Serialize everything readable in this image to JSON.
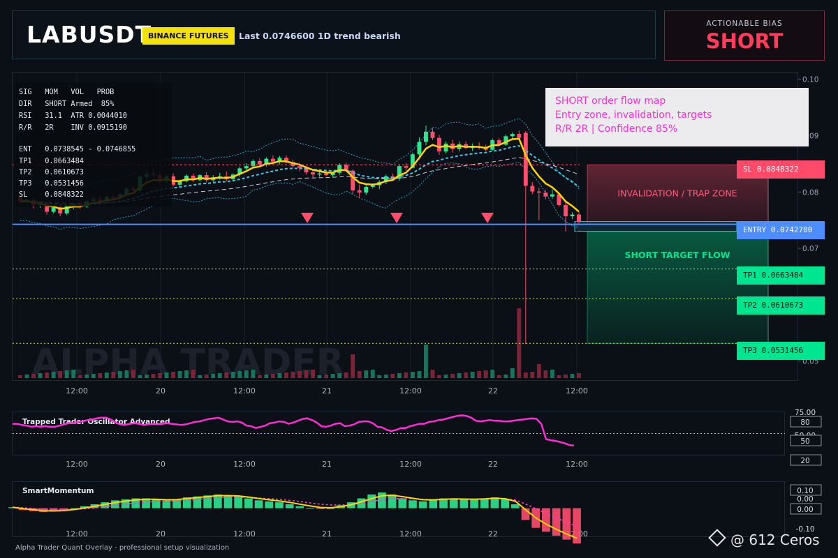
{
  "header": {
    "symbol": "LABUSDT",
    "exchange_badge": "BINANCE FUTURES",
    "status_line": "Last 0.0746600   1D trend bearish"
  },
  "bias": {
    "label": "ACTIONABLE BIAS",
    "value": "SHORT"
  },
  "colors": {
    "bull": "#2ee58f",
    "bear": "#ff4d6d",
    "ema": "#ffd400",
    "stop": "#ff5c7a",
    "entry": "#4d8dff",
    "target": "#00e58f",
    "accent_magenta": "#ff2bd6",
    "banner_yellow": "#f5e10a"
  },
  "stats_panel": {
    "rows": [
      "SIG   MOM   VOL   PROB",
      "DIR   SHORT Armed  85%",
      "RSI   31.1  ATR 0.0044010",
      "R/R   2R    INV 0.0915190",
      "",
      "ENT   0.0738545 - 0.0746855",
      "TP1   0.0663484",
      "TP2   0.0610673",
      "TP3   0.0531456",
      "SL    0.0848322"
    ]
  },
  "annotation_box": {
    "lines": [
      "SHORT order flow map",
      "Entry zone, invalidation, targets",
      "R/R 2R | Confidence 85%"
    ]
  },
  "watermark": "ALPHA TRADER",
  "zones": {
    "invalidation_label": "INVALIDATION / TRAP ZONE",
    "target_label": "SHORT TARGET FLOW"
  },
  "levels": [
    {
      "key": "sl",
      "label": "SL 0.0848322",
      "price": 0.0848322
    },
    {
      "key": "entry",
      "label": "ENTRY 0.0742700",
      "price": 0.07427
    },
    {
      "key": "tp1",
      "label": "TP1 0.0663484",
      "price": 0.0663484
    },
    {
      "key": "tp2",
      "label": "TP2 0.0610673",
      "price": 0.0610673
    },
    {
      "key": "tp3",
      "label": "TP3 0.0531456",
      "price": 0.0531456
    }
  ],
  "chart_data": {
    "type": "candlestick",
    "price_axis": {
      "ticks": [
        "0.10",
        "0.09",
        "0.08",
        "0.07",
        "0.06",
        "0.05"
      ],
      "tick_values": [
        0.1,
        0.09,
        0.08,
        0.07,
        0.06,
        0.05
      ],
      "ylim": [
        0.0465,
        0.1012
      ]
    },
    "time_axis": {
      "labels": [
        "12:00",
        "20",
        "12:00",
        "21",
        "12:00",
        "22",
        "12:00"
      ]
    },
    "candles": [
      [
        0.0791,
        0.0795,
        0.0777,
        0.0783
      ],
      [
        0.0783,
        0.0788,
        0.0778,
        0.0786
      ],
      [
        0.0786,
        0.079,
        0.0771,
        0.0776
      ],
      [
        0.0776,
        0.0786,
        0.0772,
        0.078
      ],
      [
        0.078,
        0.0784,
        0.076,
        0.0765
      ],
      [
        0.0765,
        0.0778,
        0.0762,
        0.0773
      ],
      [
        0.0773,
        0.0776,
        0.0757,
        0.0762
      ],
      [
        0.0762,
        0.0778,
        0.0759,
        0.0775
      ],
      [
        0.0775,
        0.0782,
        0.0769,
        0.0779
      ],
      [
        0.0779,
        0.0784,
        0.077,
        0.0774
      ],
      [
        0.0774,
        0.0786,
        0.0772,
        0.0784
      ],
      [
        0.0784,
        0.0792,
        0.078,
        0.0787
      ],
      [
        0.0787,
        0.0793,
        0.0781,
        0.0783
      ],
      [
        0.0783,
        0.0794,
        0.0782,
        0.0792
      ],
      [
        0.0792,
        0.0797,
        0.0786,
        0.0789
      ],
      [
        0.0789,
        0.0798,
        0.0787,
        0.0796
      ],
      [
        0.0796,
        0.0809,
        0.0794,
        0.0806
      ],
      [
        0.0806,
        0.0812,
        0.08,
        0.0803
      ],
      [
        0.0803,
        0.083,
        0.0801,
        0.0827
      ],
      [
        0.0827,
        0.0838,
        0.082,
        0.0832
      ],
      [
        0.0832,
        0.0839,
        0.0826,
        0.083
      ],
      [
        0.083,
        0.0836,
        0.0815,
        0.0819
      ],
      [
        0.0819,
        0.0831,
        0.0816,
        0.0828
      ],
      [
        0.0828,
        0.0833,
        0.081,
        0.0813
      ],
      [
        0.0813,
        0.0822,
        0.0809,
        0.0819
      ],
      [
        0.0819,
        0.0831,
        0.0817,
        0.0829
      ],
      [
        0.0829,
        0.0833,
        0.0818,
        0.0821
      ],
      [
        0.0821,
        0.0832,
        0.0819,
        0.083
      ],
      [
        0.083,
        0.0835,
        0.0817,
        0.0821
      ],
      [
        0.0821,
        0.083,
        0.0818,
        0.0826
      ],
      [
        0.0826,
        0.0834,
        0.0822,
        0.0828
      ],
      [
        0.0828,
        0.0836,
        0.0819,
        0.0823
      ],
      [
        0.0823,
        0.0833,
        0.082,
        0.0831
      ],
      [
        0.0831,
        0.0845,
        0.0827,
        0.0842
      ],
      [
        0.0842,
        0.0851,
        0.0836,
        0.0846
      ],
      [
        0.0846,
        0.0858,
        0.0842,
        0.0855
      ],
      [
        0.0855,
        0.086,
        0.0846,
        0.0849
      ],
      [
        0.0849,
        0.0862,
        0.0845,
        0.0859
      ],
      [
        0.0859,
        0.0865,
        0.0852,
        0.0854
      ],
      [
        0.0854,
        0.0864,
        0.0849,
        0.0861
      ],
      [
        0.0861,
        0.0865,
        0.0851,
        0.0853
      ],
      [
        0.0853,
        0.0858,
        0.0843,
        0.0846
      ],
      [
        0.0846,
        0.0852,
        0.0837,
        0.0843
      ],
      [
        0.0843,
        0.0846,
        0.0831,
        0.0835
      ],
      [
        0.0835,
        0.0839,
        0.0826,
        0.0831
      ],
      [
        0.0831,
        0.0836,
        0.0827,
        0.0833
      ],
      [
        0.0833,
        0.0838,
        0.0828,
        0.083
      ],
      [
        0.083,
        0.0836,
        0.0826,
        0.0834
      ],
      [
        0.0834,
        0.0851,
        0.083,
        0.0848
      ],
      [
        0.0848,
        0.0852,
        0.0835,
        0.0838
      ],
      [
        0.0838,
        0.084,
        0.0797,
        0.0803
      ],
      [
        0.0803,
        0.0813,
        0.079,
        0.0799
      ],
      [
        0.0799,
        0.0812,
        0.0795,
        0.0809
      ],
      [
        0.0809,
        0.0815,
        0.0806,
        0.0812
      ],
      [
        0.0812,
        0.0821,
        0.0805,
        0.0818
      ],
      [
        0.0818,
        0.0831,
        0.0814,
        0.0828
      ],
      [
        0.0828,
        0.0833,
        0.0821,
        0.0824
      ],
      [
        0.0824,
        0.0849,
        0.082,
        0.0846
      ],
      [
        0.0846,
        0.0852,
        0.0838,
        0.0843
      ],
      [
        0.0843,
        0.087,
        0.0842,
        0.0867
      ],
      [
        0.0867,
        0.0897,
        0.0858,
        0.0889
      ],
      [
        0.0889,
        0.0918,
        0.0883,
        0.0907
      ],
      [
        0.0907,
        0.0913,
        0.0892,
        0.0896
      ],
      [
        0.0896,
        0.0901,
        0.0866,
        0.0872
      ],
      [
        0.0872,
        0.089,
        0.0868,
        0.0886
      ],
      [
        0.0886,
        0.0893,
        0.087,
        0.0876
      ],
      [
        0.0876,
        0.089,
        0.0872,
        0.0885
      ],
      [
        0.0885,
        0.089,
        0.0876,
        0.0878
      ],
      [
        0.0878,
        0.0886,
        0.0873,
        0.0881
      ],
      [
        0.0881,
        0.0888,
        0.0875,
        0.0879
      ],
      [
        0.0879,
        0.0884,
        0.0872,
        0.0875
      ],
      [
        0.0875,
        0.0895,
        0.0873,
        0.0892
      ],
      [
        0.0892,
        0.0896,
        0.0882,
        0.0884
      ],
      [
        0.0884,
        0.0902,
        0.0882,
        0.0899
      ],
      [
        0.0899,
        0.0906,
        0.0893,
        0.0903
      ],
      [
        0.0903,
        0.0909,
        0.0892,
        0.0896
      ],
      [
        0.0905,
        0.0908,
        0.053,
        0.0811
      ],
      [
        0.0811,
        0.0818,
        0.0796,
        0.0801
      ],
      [
        0.0801,
        0.0808,
        0.075,
        0.0799
      ],
      [
        0.0799,
        0.0803,
        0.0787,
        0.0792
      ],
      [
        0.0792,
        0.0805,
        0.0788,
        0.0796
      ],
      [
        0.0796,
        0.0799,
        0.0774,
        0.0777
      ],
      [
        0.0777,
        0.0785,
        0.073,
        0.0757
      ],
      [
        0.0757,
        0.0764,
        0.0752,
        0.076
      ],
      [
        0.076,
        0.0764,
        0.0744,
        0.0747
      ]
    ],
    "volume_peaks": [
      {
        "index": 50,
        "value": "high"
      },
      {
        "index": 75,
        "value": "spike"
      }
    ],
    "indicators": [
      {
        "name": "Trapped Trader Oscillator Advanced",
        "levels": [
          "75.00",
          "80",
          "50.00",
          "50",
          "20"
        ],
        "values": [
          66,
          66,
          64,
          63,
          61,
          62,
          61,
          62,
          61,
          61,
          63,
          65,
          67,
          67,
          69,
          70,
          72,
          73,
          75,
          76,
          76,
          73,
          68,
          65,
          64,
          66,
          67,
          66,
          64,
          65,
          66,
          65,
          66,
          67,
          66,
          65,
          64,
          65,
          67,
          69,
          70,
          72,
          74,
          75,
          76,
          73,
          70,
          69,
          70,
          68,
          63,
          62,
          59,
          61,
          63,
          67,
          68,
          70,
          69,
          66,
          68,
          71,
          74,
          75,
          72,
          68,
          62,
          61,
          63,
          66,
          67,
          62,
          63,
          65,
          69,
          70,
          70,
          67,
          61,
          60,
          56,
          54,
          56,
          59,
          59,
          62,
          64,
          66,
          66,
          69,
          70,
          72,
          73,
          75,
          77,
          79,
          80,
          79,
          76,
          71,
          70,
          71,
          72,
          71,
          71,
          70,
          70,
          71,
          72,
          73,
          74,
          75,
          74,
          66,
          41,
          39,
          38,
          36,
          34,
          31,
          30
        ]
      },
      {
        "name": "SmartMomentum",
        "levels": [
          "0.10",
          "0.00",
          "0.00",
          "-0.10"
        ],
        "values": [
          0.005,
          -0.01,
          -0.015,
          -0.02,
          -0.015,
          -0.01,
          0.0,
          0.01,
          0.02,
          0.03,
          0.04,
          0.045,
          0.05,
          0.05,
          0.045,
          0.04,
          0.045,
          0.055,
          0.06,
          0.065,
          0.07,
          0.065,
          0.06,
          0.05,
          0.04,
          0.035,
          0.03,
          0.02,
          0.01,
          0.0,
          -0.005,
          0.0,
          0.015,
          0.03,
          0.05,
          0.07,
          0.08,
          0.07,
          0.05,
          0.04,
          0.035,
          0.04,
          0.05,
          0.05,
          0.045,
          0.045,
          0.05,
          0.055,
          0.045,
          0.02,
          -0.06,
          -0.1,
          -0.12,
          -0.14,
          -0.16,
          -0.18
        ]
      }
    ]
  }
}
